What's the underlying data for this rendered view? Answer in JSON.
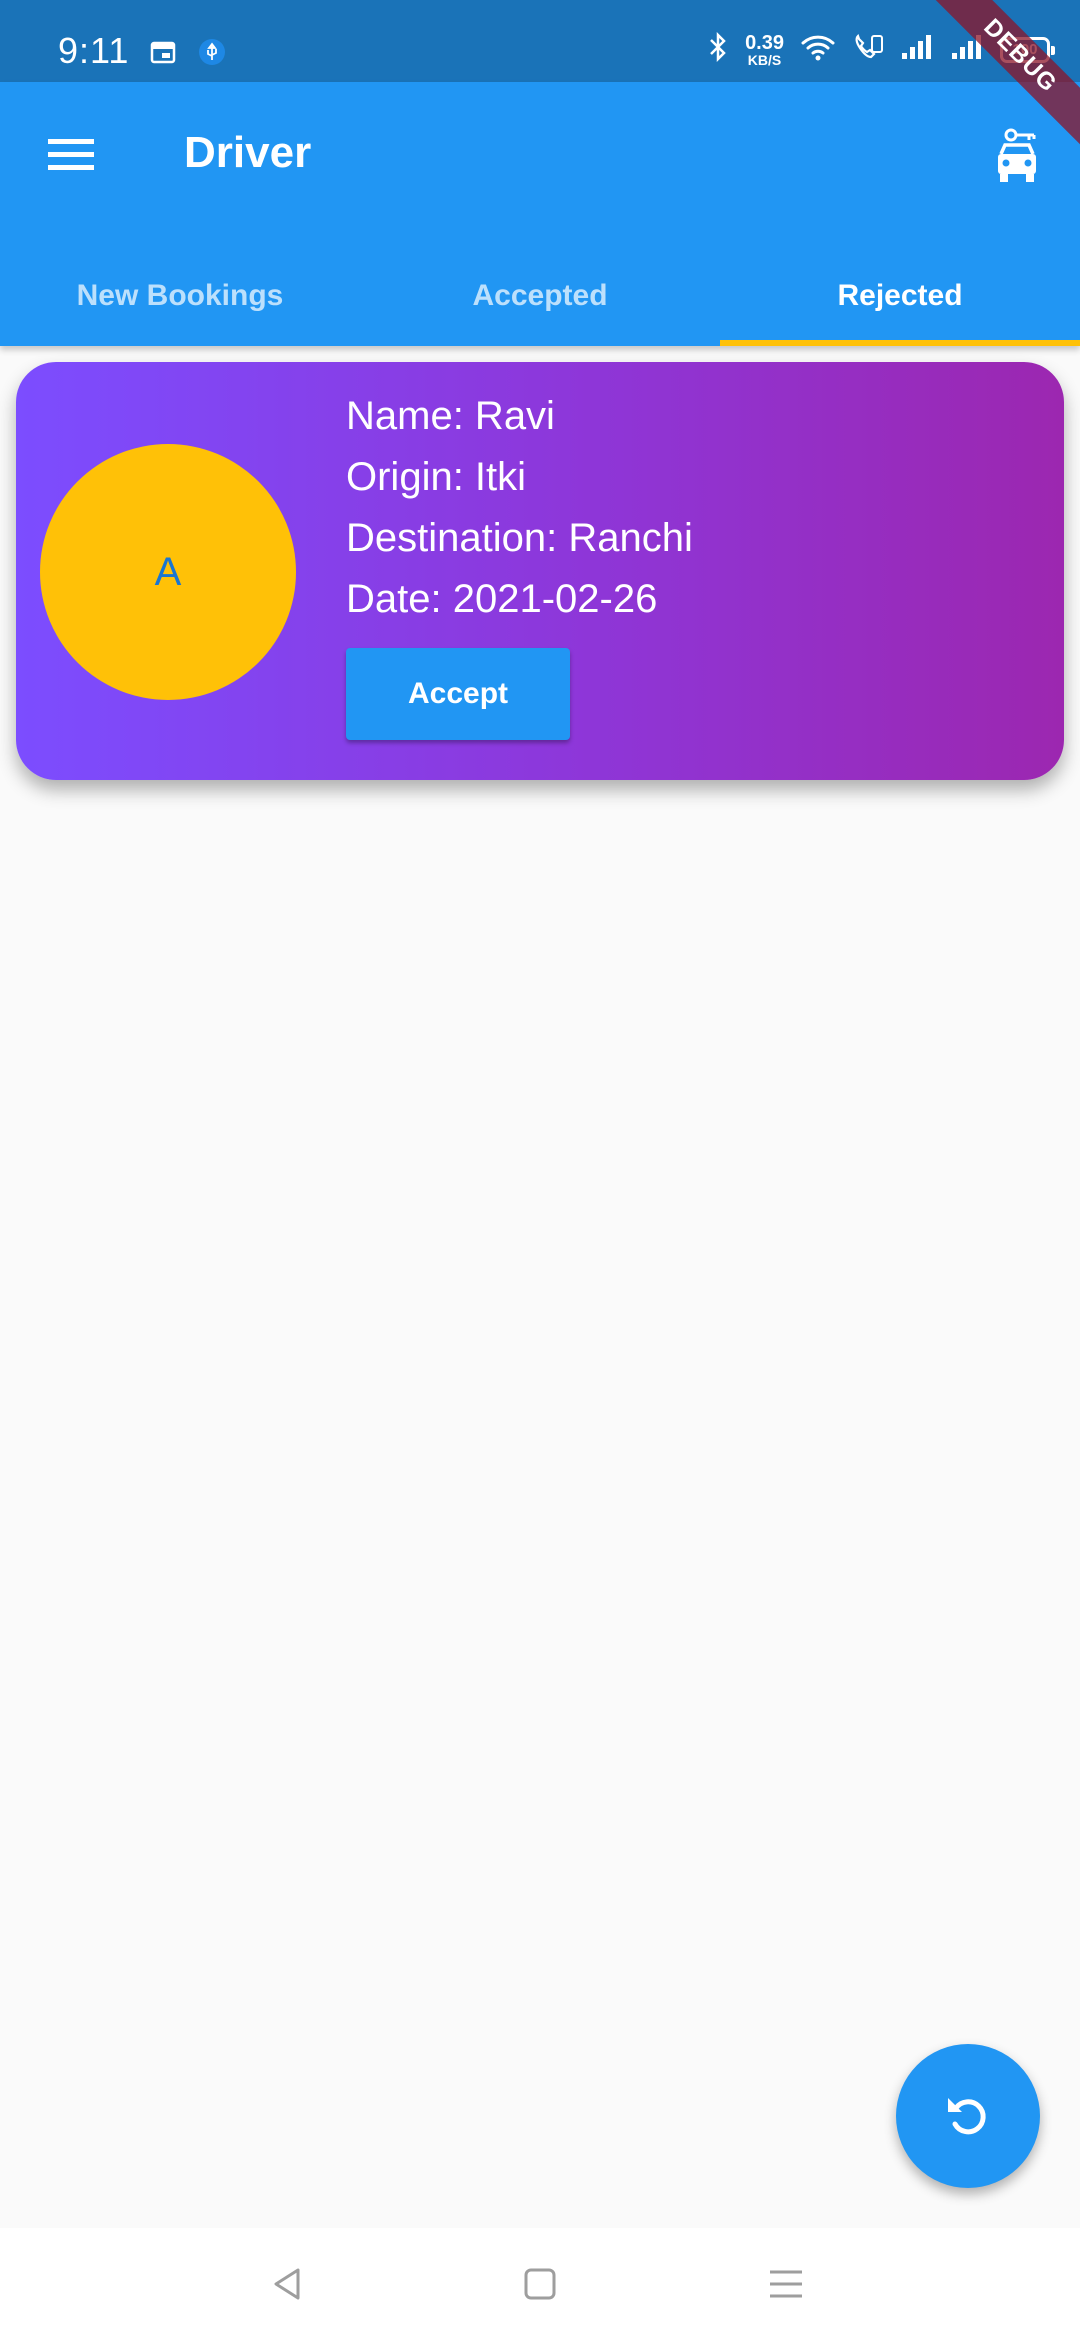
{
  "status_bar": {
    "time": "9:11",
    "net_speed_value": "0.39",
    "net_speed_unit": "KB/S",
    "battery": "100"
  },
  "debug_banner": "DEBUG",
  "app_bar": {
    "title": "Driver"
  },
  "tabs": [
    {
      "label": "New Bookings",
      "active": false
    },
    {
      "label": "Accepted",
      "active": false
    },
    {
      "label": "Rejected",
      "active": true
    }
  ],
  "booking": {
    "avatar_letter": "A",
    "name": "Name: Ravi",
    "origin": "Origin: Itki",
    "destination": "Destination: Ranchi",
    "date": "Date: 2021-02-26",
    "accept_label": "Accept"
  },
  "colors": {
    "status_bar": "#1a73b8",
    "app_bar": "#2196f3",
    "tab_indicator": "#ffc107",
    "avatar": "#ffc107",
    "card_gradient_start": "#7c4dff",
    "card_gradient_end": "#9c27b0"
  },
  "icons": {
    "menu": "menu-icon",
    "car": "car-icon",
    "refresh": "refresh-icon"
  }
}
